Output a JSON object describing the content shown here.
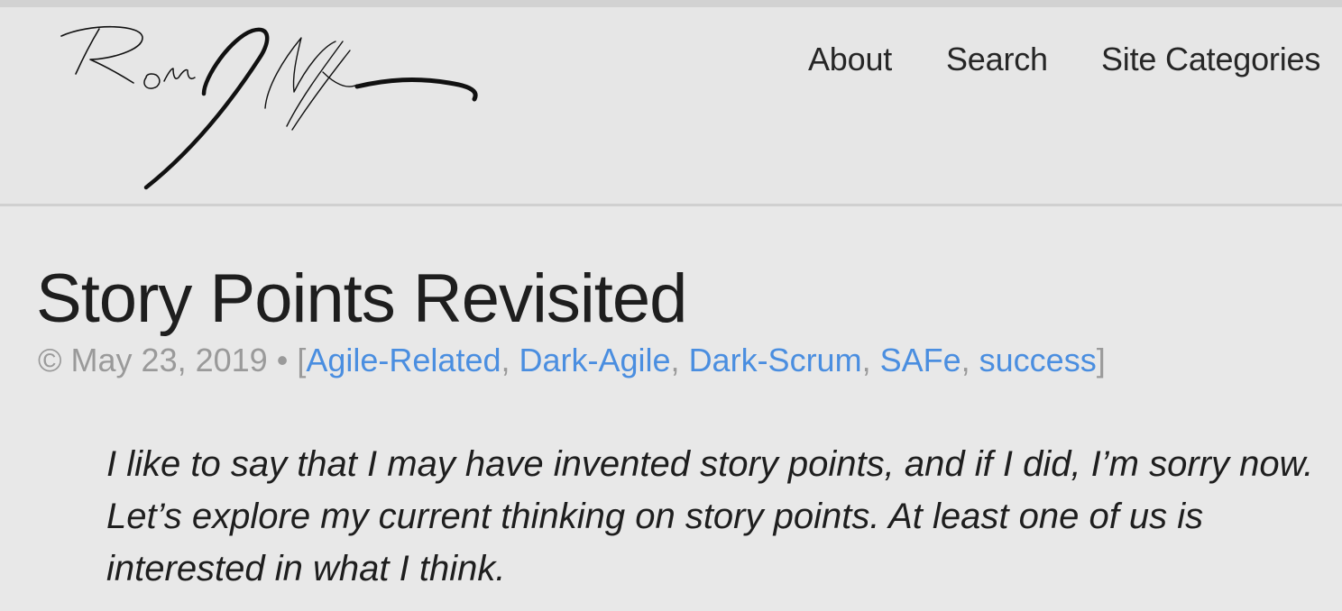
{
  "site": {
    "logo_signature": "Ron Jeffries"
  },
  "nav": {
    "items": [
      {
        "label": "About"
      },
      {
        "label": "Search"
      },
      {
        "label": "Site Categories"
      }
    ]
  },
  "post": {
    "title": "Story Points Revisited",
    "copyright_symbol": "©",
    "date": "May 23, 2019",
    "separator": "•",
    "categories_open": "[",
    "categories_close": "]",
    "category_delimiter": ", ",
    "categories": [
      {
        "label": "Agile-Related"
      },
      {
        "label": "Dark-Agile"
      },
      {
        "label": "Dark-Scrum"
      },
      {
        "label": "SAFe"
      },
      {
        "label": "success"
      }
    ],
    "lede": "I like to say that I may have invented story points, and if I did, I’m sorry now. Let’s explore my current thinking on story points. At least one of us is interested in what I think."
  },
  "colors": {
    "page_background": "#e8e8e8",
    "header_background": "#e6e6e6",
    "link_blue": "#4a8ee0",
    "meta_gray": "#9a9a9a",
    "text_dark": "#1e1e1e"
  }
}
